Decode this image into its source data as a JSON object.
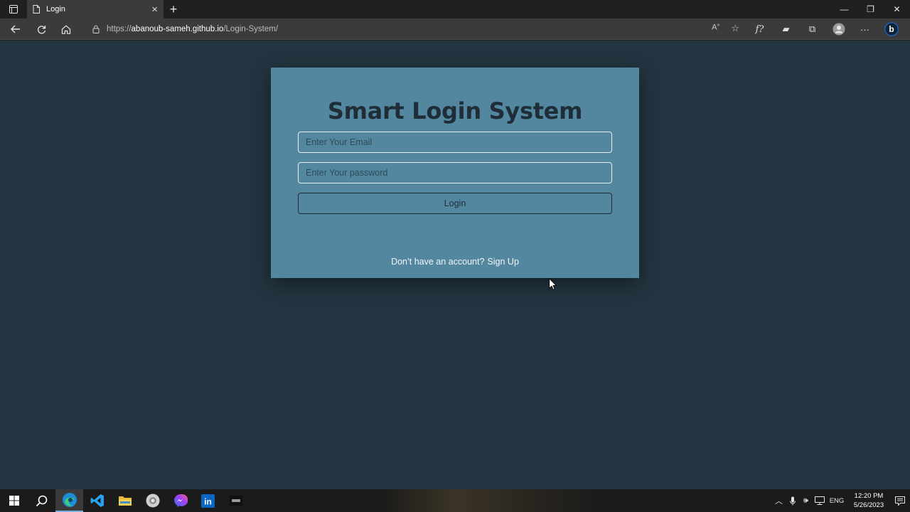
{
  "browser": {
    "tab_title": "Login",
    "url_scheme": "https://",
    "url_host": "abanoub-sameh.github.io",
    "url_path": "/Login-System/"
  },
  "page": {
    "heading": "Smart Login System",
    "email_placeholder": "Enter Your Email",
    "password_placeholder": "Enter Your password",
    "login_label": "Login",
    "signup_prompt": "Don’t have an account?",
    "signup_link": "Sign Up"
  },
  "taskbar": {
    "language": "ENG",
    "time": "12:20 PM",
    "date": "5/26/2023"
  },
  "colors": {
    "page_bg": "#233540",
    "card_bg": "#52879f",
    "heading": "#1e2d38"
  }
}
